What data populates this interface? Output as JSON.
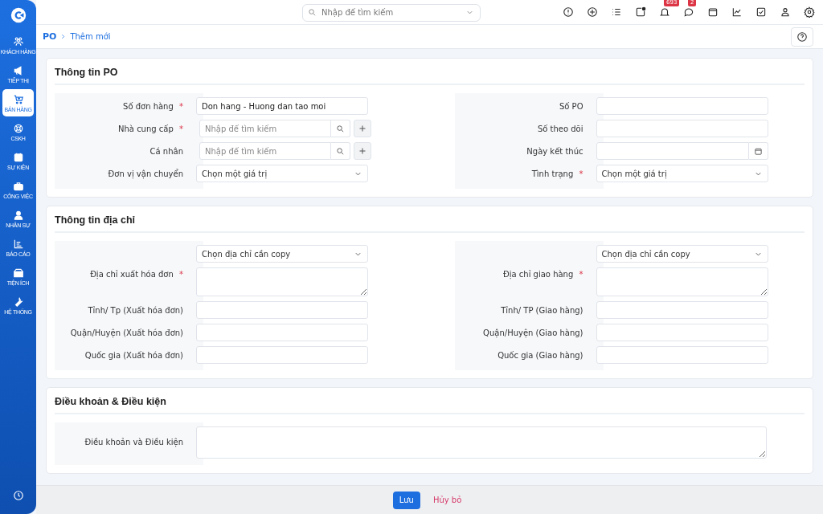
{
  "sidebar": {
    "items": [
      {
        "label": "KHÁCH HÀNG",
        "selected": false
      },
      {
        "label": "TIẾP THỊ",
        "selected": false
      },
      {
        "label": "BÁN HÀNG",
        "selected": true
      },
      {
        "label": "CSKH",
        "selected": false
      },
      {
        "label": "SỰ KIỆN",
        "selected": false
      },
      {
        "label": "CÔNG VIỆC",
        "selected": false
      },
      {
        "label": "NHÂN SỰ",
        "selected": false
      },
      {
        "label": "BÁO CÁO",
        "selected": false
      },
      {
        "label": "TIỆN ÍCH",
        "selected": false
      },
      {
        "label": "HỆ THỐNG",
        "selected": false
      }
    ]
  },
  "search": {
    "placeholder": "Nhập để tìm kiếm"
  },
  "toolbar": {
    "bell_badge": "693",
    "chat_badge": "2"
  },
  "breadcrumb": [
    "PO",
    "Thêm mới"
  ],
  "sections": [
    {
      "title": "Thông tin PO",
      "columns": [
        [
          {
            "label": "Số đơn hàng",
            "required_mark": "*",
            "kind": "text",
            "value": "Don hang - Huong dan tao moi"
          },
          {
            "label": "Nhà cung cấp",
            "required_mark": "*",
            "kind": "lookup",
            "placeholder": "Nhập để tìm kiếm"
          },
          {
            "label": "Cá nhân",
            "kind": "lookup",
            "placeholder": "Nhập để tìm kiếm"
          },
          {
            "label": "Đơn vị vận chuyển",
            "kind": "select",
            "value": "Chọn một giá trị"
          }
        ],
        [
          {
            "label": "Số PO",
            "kind": "text"
          },
          {
            "label": "Số theo dõi",
            "kind": "text"
          },
          {
            "label": "Ngày kết thúc",
            "kind": "date"
          },
          {
            "label": "Tình trạng",
            "required_mark": "*",
            "kind": "select",
            "value": "Chọn một giá trị"
          }
        ]
      ]
    },
    {
      "title": "Thông tin địa chỉ",
      "columns": [
        [
          {
            "kind": "select",
            "value": "Chọn địa chỉ cần copy"
          },
          {
            "label": "Địa chỉ xuất hóa đơn",
            "required_mark": "*",
            "kind": "textarea"
          },
          {
            "label": "Tỉnh/ Tp (Xuất hóa đơn)",
            "kind": "text"
          },
          {
            "label": "Quận/Huyện (Xuất hóa đơn)",
            "kind": "text"
          },
          {
            "label": "Quốc gia (Xuất hóa đơn)",
            "kind": "text"
          }
        ],
        [
          {
            "kind": "select",
            "value": "Chọn địa chỉ cần copy"
          },
          {
            "label": "Địa chỉ giao hàng",
            "required_mark": "*",
            "kind": "textarea"
          },
          {
            "label": "Tỉnh/ TP (Giao hàng)",
            "kind": "text"
          },
          {
            "label": "Quận/Huyện (Giao hàng)",
            "kind": "text"
          },
          {
            "label": "Quốc gia (Giao hàng)",
            "kind": "text"
          }
        ]
      ]
    },
    {
      "title": "Điều khoản & Điều kiện",
      "columns": [
        [
          {
            "label": "Điều khoản và Điều kiện",
            "kind": "wide"
          }
        ]
      ]
    }
  ],
  "footer": {
    "save": "Lưu",
    "cancel": "Hủy bỏ"
  }
}
